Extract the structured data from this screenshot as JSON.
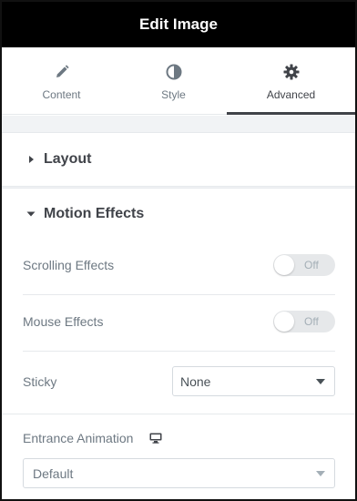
{
  "header": {
    "title": "Edit Image"
  },
  "tabs": [
    {
      "label": "Content",
      "icon": "pencil-icon"
    },
    {
      "label": "Style",
      "icon": "half-circle-icon"
    },
    {
      "label": "Advanced",
      "icon": "gear-icon",
      "active": true
    }
  ],
  "sections": {
    "layout": {
      "title": "Layout",
      "expanded": false
    },
    "motion": {
      "title": "Motion Effects",
      "expanded": true
    }
  },
  "motion": {
    "scrolling_effects": {
      "label": "Scrolling Effects",
      "toggle": "Off"
    },
    "mouse_effects": {
      "label": "Mouse Effects",
      "toggle": "Off"
    },
    "sticky": {
      "label": "Sticky",
      "value": "None"
    },
    "entrance_animation": {
      "label": "Entrance Animation",
      "device_icon": "desktop-icon",
      "value": "Default"
    }
  },
  "colors": {
    "header_bg": "#000000",
    "active_tab": "#404349",
    "panel_bg": "#f1f3f5",
    "toggle_bg": "#e6e8ea"
  }
}
